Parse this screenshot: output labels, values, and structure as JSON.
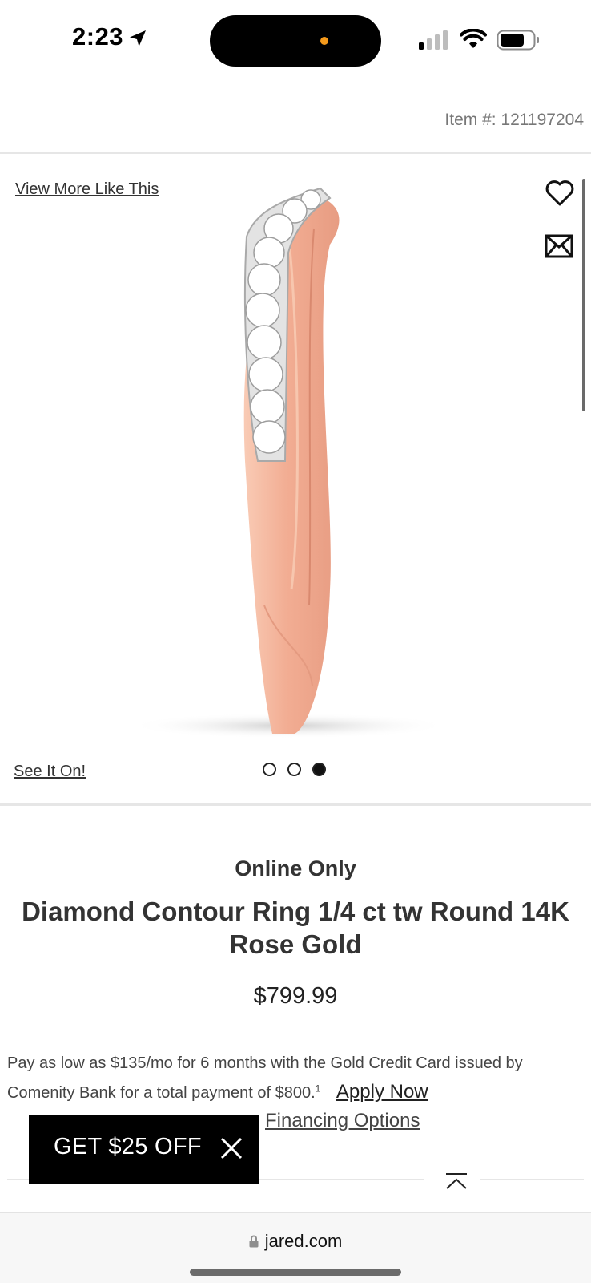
{
  "status_bar": {
    "time": "2:23",
    "location_icon": "location-arrow-icon",
    "signal_icon": "cellular-signal-icon",
    "wifi_icon": "wifi-icon",
    "battery_icon": "battery-icon",
    "island_indicator_color": "#f59a1b"
  },
  "header": {
    "item_number": "Item #: 121197204"
  },
  "gallery": {
    "view_more_label": "View More Like This",
    "see_it_on_label": "See It On!",
    "favorite_icon": "heart-icon",
    "share_icon": "mail-icon",
    "image_count": 3,
    "active_image": 3
  },
  "product": {
    "badge": "Online Only",
    "title": "Diamond Contour Ring 1/4 ct tw Round 14K Rose Gold",
    "price": "$799.99",
    "financing_text": "Pay as low as $135/mo for 6 months with the Gold Credit Card issued by Comenity Bank for a total payment of $800.",
    "financing_footnote": "1",
    "apply_now_label": "Apply Now",
    "financing_options_label": "Financing Options"
  },
  "promo": {
    "label": "GET $25 OFF",
    "close_icon": "close-icon"
  },
  "browser": {
    "url": "jared.com",
    "lock_icon": "lock-icon",
    "back_to_top_icon": "chevron-up-icon"
  },
  "colors": {
    "ring_rose_gold": "#f2b49a",
    "promo_background": "#000000",
    "divider": "#e6e6e6"
  }
}
